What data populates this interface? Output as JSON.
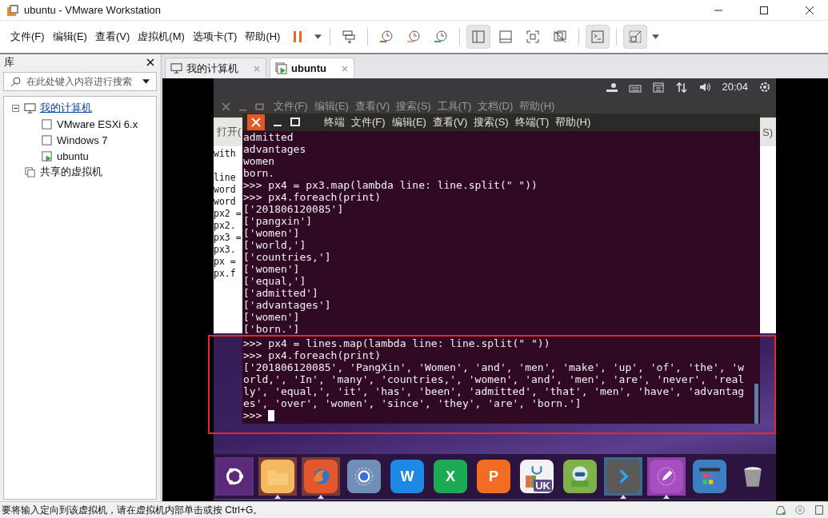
{
  "window": {
    "title": "ubuntu - VMware Workstation"
  },
  "menu": [
    "文件(F)",
    "编辑(E)",
    "查看(V)",
    "虚拟机(M)",
    "选项卡(T)",
    "帮助(H)"
  ],
  "toolbar": [
    {
      "kind": "pause",
      "selected": false
    },
    {
      "kind": "caret"
    },
    {
      "kind": "sep"
    },
    {
      "kind": "send-keys",
      "selected": false
    },
    {
      "kind": "sep"
    },
    {
      "kind": "snap-take",
      "selected": false
    },
    {
      "kind": "snap-revert",
      "selected": false
    },
    {
      "kind": "snap-manage",
      "selected": false
    },
    {
      "kind": "sep"
    },
    {
      "kind": "view-library",
      "selected": true
    },
    {
      "kind": "view-thumb",
      "selected": false
    },
    {
      "kind": "fullscreen",
      "selected": false
    },
    {
      "kind": "unity",
      "selected": false
    },
    {
      "kind": "sep"
    },
    {
      "kind": "console",
      "selected": true
    },
    {
      "kind": "sep"
    },
    {
      "kind": "stretch",
      "selected": true
    },
    {
      "kind": "caret"
    }
  ],
  "library": {
    "title": "库",
    "search": {
      "placeholder": "在此处键入内容进行搜索"
    },
    "tree": [
      {
        "label": "我的计算机",
        "kind": "computer",
        "selected": true,
        "expanded": true,
        "children": [
          {
            "label": "VMware ESXi 6.x",
            "kind": "vm",
            "selected": false
          },
          {
            "label": "Windows 7",
            "kind": "vm",
            "selected": false
          },
          {
            "label": "ubuntu",
            "kind": "vm-running",
            "selected": false
          }
        ]
      },
      {
        "label": "共享的虚拟机",
        "kind": "shared",
        "selected": false
      }
    ]
  },
  "tabs": [
    {
      "label": "我的计算机",
      "kind": "computer",
      "selected": false
    },
    {
      "label": "ubuntu",
      "kind": "vm-running",
      "selected": true
    }
  ],
  "guest": {
    "clock": "20:04",
    "editor": {
      "menu": [
        "文件(F)",
        "编辑(E)",
        "查看(V)",
        "搜索(S)",
        "工具(T)",
        "文档(D)",
        "帮助(H)"
      ],
      "toolbar_left": "打开(",
      "toolbar_right": "S)",
      "blocks": [
        [
          "with"
        ],
        [
          "line",
          "word",
          "word",
          "px2 =",
          "px2.",
          "px3 =",
          "px3.",
          "px =",
          "px.f"
        ]
      ]
    },
    "terminal": {
      "menu": [
        "终端",
        "文件(F)",
        "编辑(E)",
        "查看(V)",
        "搜索(S)",
        "终端(T)",
        "帮助(H)"
      ],
      "lines": [
        "admitted",
        "advantages",
        "women",
        "born.",
        ">>> px4 = px3.map(lambda line: line.split(\" \"))",
        ">>> px4.foreach(print)",
        "['201806120085']",
        "['pangxin']",
        "['women']",
        "['world,']",
        "['countries,']",
        "['women']",
        "['equal,']",
        "['admitted']",
        "['advantages']",
        "['women']",
        "['born.']",
        ">>> px4 = lines.map(lambda line: line.split(\" \"))",
        ">>> px4.foreach(print)",
        "['201806120085', 'PangXin', 'Women', 'and', 'men', 'make', 'up', 'of', 'the', 'w",
        "orld,', 'In', 'many', 'countries,', 'women', 'and', 'men', 'are', 'never', 'real",
        "ly', 'equal,', 'it', 'has', 'been', 'admitted', 'that', 'men', 'have', 'advantag",
        "es', 'over', 'women', 'since', 'they', 'are', 'born.']"
      ],
      "prompt": ">>>"
    },
    "dock": [
      {
        "kind": "ubuntu",
        "highlighted": true,
        "running": false
      },
      {
        "kind": "folder",
        "highlighted": true,
        "running": true
      },
      {
        "kind": "fox",
        "highlighted": true,
        "running": true
      },
      {
        "kind": "browser",
        "highlighted": false,
        "running": false
      },
      {
        "kind": "doc",
        "label": "W",
        "highlighted": false,
        "running": false
      },
      {
        "kind": "sheet",
        "label": "X",
        "highlighted": false,
        "running": false
      },
      {
        "kind": "slides",
        "label": "P",
        "highlighted": false,
        "running": false
      },
      {
        "kind": "bag",
        "label": "UK",
        "highlighted": false,
        "running": false
      },
      {
        "kind": "robot",
        "highlighted": false,
        "running": false
      },
      {
        "kind": "terminal",
        "highlighted": true,
        "running": true
      },
      {
        "kind": "pen",
        "highlighted": true,
        "running": true
      },
      {
        "kind": "apps",
        "highlighted": false,
        "running": false
      },
      {
        "kind": "trash",
        "highlighted": false,
        "running": false
      }
    ]
  },
  "status_bar": {
    "text": "要将输入定向到该虚拟机，请在虚拟机内部单击或按 Ctrl+G。"
  }
}
